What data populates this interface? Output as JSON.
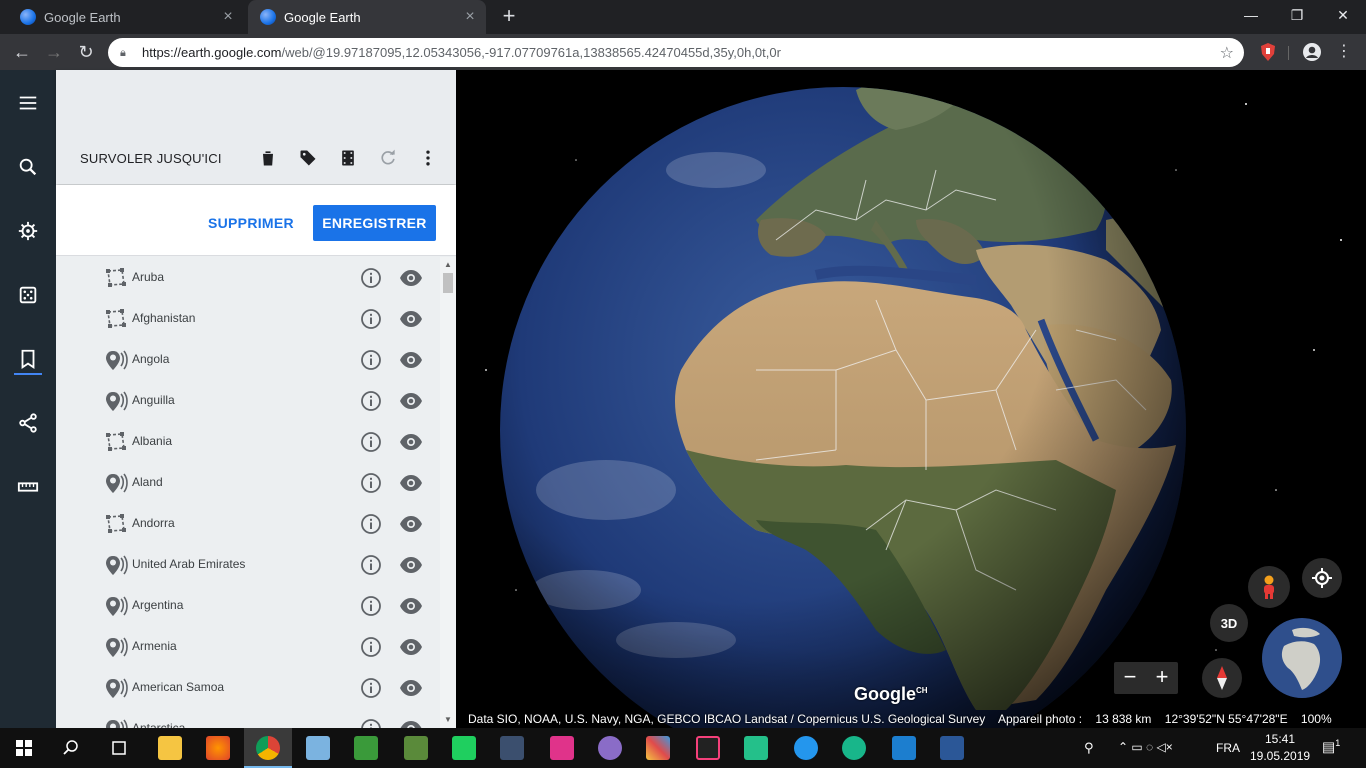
{
  "browser": {
    "tabs": [
      {
        "title": "Google Earth",
        "active": false
      },
      {
        "title": "Google Earth",
        "active": true
      }
    ],
    "new_tab": "+",
    "url_host": "https://earth.google.com",
    "url_path": "/web/@19.97187095,12.05343056,-917.07709761a,13838565.42470455d,35y,0h,0t,0r"
  },
  "panel": {
    "title": "SURVOLER JUSQU'ICI",
    "delete_label": "SUPPRIMER",
    "save_label": "ENREGISTRER",
    "items": [
      {
        "label": "Aruba",
        "type": "polygon-icon"
      },
      {
        "label": "Afghanistan",
        "type": "polygon-icon"
      },
      {
        "label": "Angola",
        "type": "placemark-icon"
      },
      {
        "label": "Anguilla",
        "type": "placemark-icon"
      },
      {
        "label": "Albania",
        "type": "polygon-icon"
      },
      {
        "label": "Aland",
        "type": "placemark-icon"
      },
      {
        "label": "Andorra",
        "type": "polygon-icon"
      },
      {
        "label": "United Arab Emirates",
        "type": "placemark-icon"
      },
      {
        "label": "Argentina",
        "type": "placemark-icon"
      },
      {
        "label": "Armenia",
        "type": "placemark-icon"
      },
      {
        "label": "American Samoa",
        "type": "placemark-icon"
      },
      {
        "label": "Antarctica",
        "type": "placemark-icon"
      }
    ]
  },
  "map": {
    "attribution": "Data SIO, NOAA, U.S. Navy, NGA, GEBCO IBCAO Landsat / Copernicus U.S. Geological Survey",
    "camera_label": "Appareil photo :",
    "camera_distance": "13 838 km",
    "coordinates": "12°39'52\"N 55°47'28\"E",
    "zoom": "100%",
    "logo": "Google",
    "logo_region": "CH",
    "btn_3d": "3D",
    "zoom_out": "−",
    "zoom_in": "+"
  },
  "taskbar": {
    "language": "FRA",
    "time": "15:41",
    "date": "19.05.2019",
    "notifications": "1"
  },
  "colors": {
    "accent": "#1a73e8",
    "rail": "#1f2a33",
    "panel_bg": "#eceff1"
  }
}
